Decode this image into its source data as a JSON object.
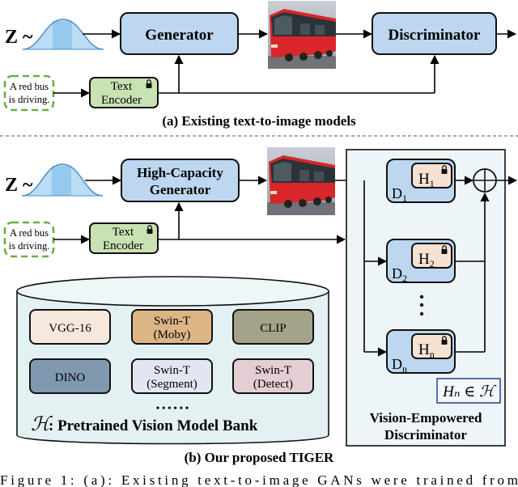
{
  "colors": {
    "generator_fill": "#bcd7ef",
    "encoder_fill": "#c9e2b3",
    "text_dash": "#6aae45",
    "gaussian": "#4a90cc",
    "gaussian_fill": "#a9d3f2",
    "disc_panel": "#eef5f8",
    "d_block": "#bcd7ef",
    "h_block": "#f7e1d3",
    "bank_fill": "#e3f1f3",
    "set_box_border": "#2f4f9a",
    "models": {
      "vgg16": "#f7e8dd",
      "swin_moby": "#dcb584",
      "clip": "#a3a38c",
      "dino": "#7f99b0",
      "swin_segment": "#e2e6f2",
      "swin_detect": "#e3cfd3"
    }
  },
  "panel_a": {
    "noise_label": "Z ~",
    "generator_label": "Generator",
    "discriminator_label": "Discriminator",
    "text_prompt": [
      "A red bus",
      "is driving."
    ],
    "encoder_label": [
      "Text",
      "Encoder"
    ],
    "encoder_icon": "lock-icon",
    "generated_image": "red-bus-image",
    "caption": "(a) Existing text-to-image models"
  },
  "panel_b": {
    "noise_label": "Z ~",
    "generator_label": [
      "High-Capacity",
      "Generator"
    ],
    "text_prompt": [
      "A red bus",
      "is driving."
    ],
    "encoder_label": [
      "Text",
      "Encoder"
    ],
    "generated_image": "red-bus-image",
    "discriminator": {
      "blocks": [
        {
          "d": "D",
          "d_sub": "1",
          "h": "H",
          "h_sub": "1"
        },
        {
          "d": "D",
          "d_sub": "2",
          "h": "H",
          "h_sub": "2"
        },
        {
          "d": "D",
          "d_sub": "n",
          "h": "H",
          "h_sub": "n"
        }
      ],
      "ellipsis": "⋮",
      "sum_symbol": "⊕",
      "set_relation": "Hₙ ∈ ℋ",
      "title": [
        "Vision-Empowered",
        "Discriminator"
      ]
    },
    "model_bank": {
      "models": [
        [
          "VGG-16"
        ],
        [
          "Swin-T",
          "(Moby)"
        ],
        [
          "CLIP"
        ],
        [
          "DINO"
        ],
        [
          "Swin-T",
          "(Segment)"
        ],
        [
          "Swin-T",
          "(Detect)"
        ]
      ],
      "more": "• • • • • •",
      "symbol": "ℋ",
      "title": ": Pretrained Vision Model Bank"
    },
    "caption": "(b) Our proposed TIGER"
  },
  "figure_caption": "Figure 1:  (a):  Existing text-to-image GANs were trained from"
}
